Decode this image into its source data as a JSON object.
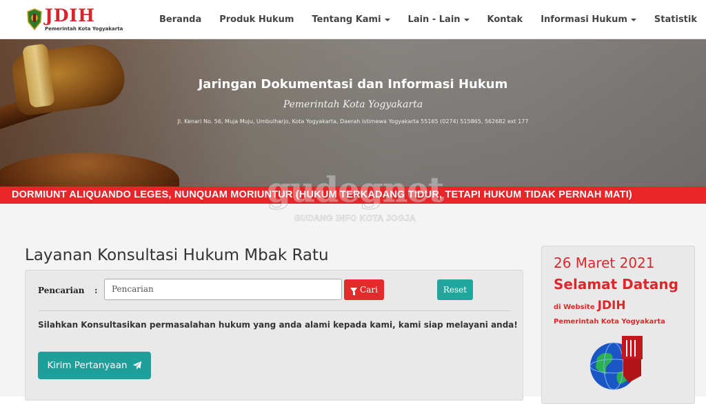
{
  "logo": {
    "text": "JDIH",
    "subtitle": "Pemerintah Kota Yogyakarta"
  },
  "nav": [
    {
      "label": "Beranda",
      "dropdown": false
    },
    {
      "label": "Produk Hukum",
      "dropdown": false
    },
    {
      "label": "Tentang Kami",
      "dropdown": true
    },
    {
      "label": "Lain - Lain",
      "dropdown": true
    },
    {
      "label": "Kontak",
      "dropdown": false
    },
    {
      "label": "Informasi Hukum",
      "dropdown": true
    },
    {
      "label": "Statistik",
      "dropdown": false
    }
  ],
  "hero": {
    "title": "Jaringan Dokumentasi dan Informasi Hukum",
    "subtitle": "Pemerintah Kota Yogyakarta",
    "address": "Jl. Kenari No. 56, Muja Muju, Umbulharjo, Kota Yogyakarta, Daerah Istimewa Yogyakarta 55165 (0274) 515865, 562682 ext 177"
  },
  "ribbon": "DORMIUNT ALIQUANDO LEGES, NUNQUAM MORIUNTUR (HUKUM TERKADANG TIDUR, TETAPI HUKUM TIDAK PERNAH MATI)",
  "main": {
    "title": "Layanan Konsultasi Hukum Mbak Ratu",
    "search": {
      "label": "Pencarian",
      "colon": ":",
      "value": "Pencarian",
      "search_button": "Cari",
      "reset_button": "Reset"
    },
    "info": "Silahkan Konsultasikan permasalahan hukum yang anda alami kepada kami, kami siap melayani anda!",
    "send_button": "Kirim Pertanyaan"
  },
  "sidebar": {
    "date": "26 Maret 2021",
    "welcome": "Selamat Datang",
    "website_prefix": "di Website",
    "website_name": "JDIH",
    "org": "Pemerintah Kota Yogyakarta"
  },
  "watermark": {
    "main": "gudegnet",
    "tagline": "GUDANG INFO KOTA JOGJA"
  },
  "colors": {
    "accent_red": "#e22b2b",
    "teal": "#21a69e",
    "ribbon": "#e8262a"
  }
}
